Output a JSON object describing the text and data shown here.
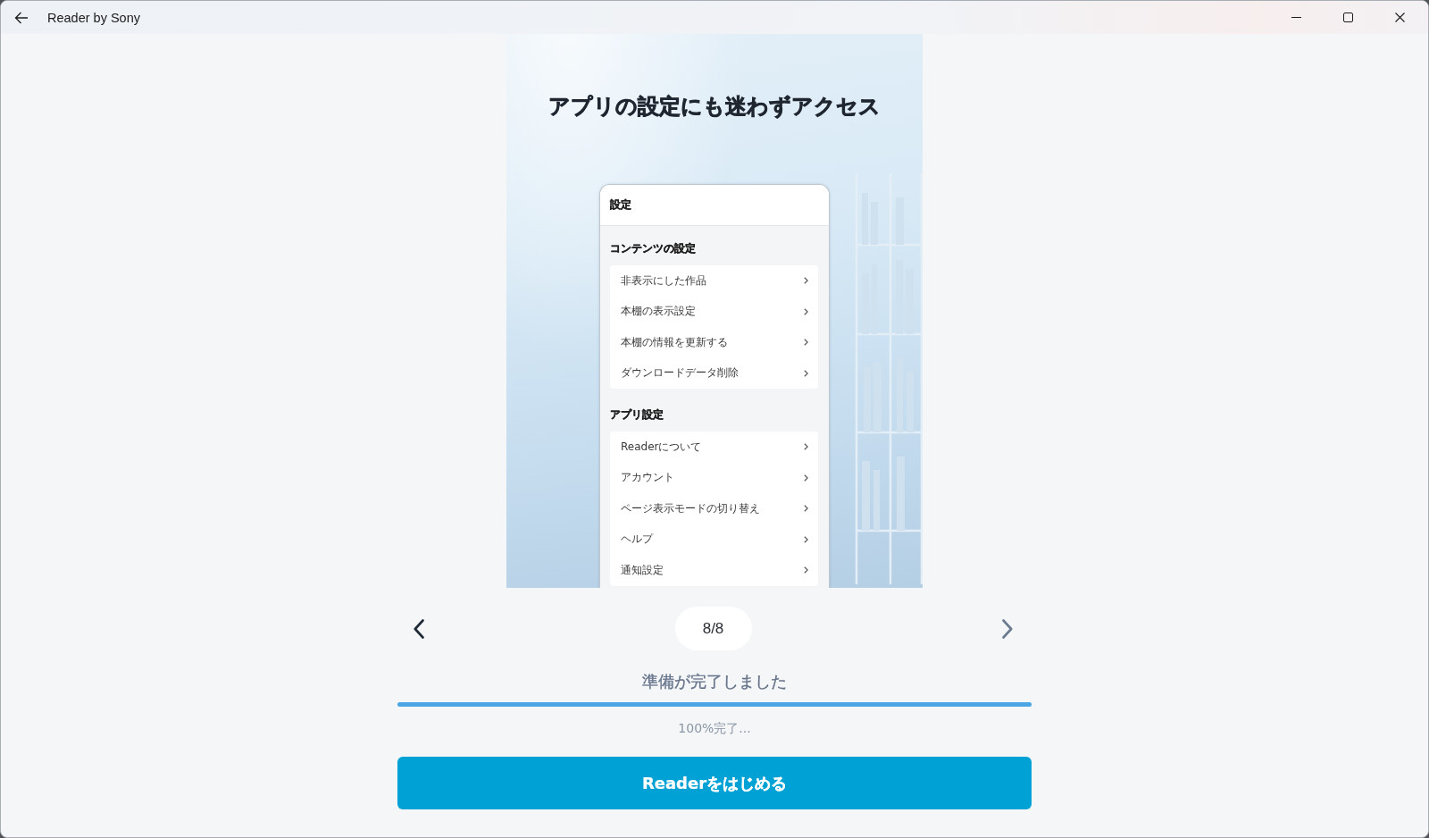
{
  "window": {
    "title": "Reader by Sony"
  },
  "slide": {
    "heading": "アプリの設定にも迷わずアクセス",
    "phone": {
      "title": "設定",
      "sections": [
        {
          "heading": "コンテンツの設定",
          "items": [
            "非表示にした作品",
            "本棚の表示設定",
            "本棚の情報を更新する",
            "ダウンロードデータ削除"
          ]
        },
        {
          "heading": "アプリ設定",
          "items": [
            "Readerについて",
            "アカウント",
            "ページ表示モードの切り替え",
            "ヘルプ",
            "通知設定"
          ]
        }
      ]
    }
  },
  "pager": {
    "previous": {
      "disabled": false
    },
    "counter": "8/8",
    "next": {
      "disabled": true
    }
  },
  "progress": {
    "status": "準備が完了しました",
    "level": 1,
    "reading": "100%完了..."
  },
  "start_button": {
    "label": "Readerをはじめる"
  }
}
